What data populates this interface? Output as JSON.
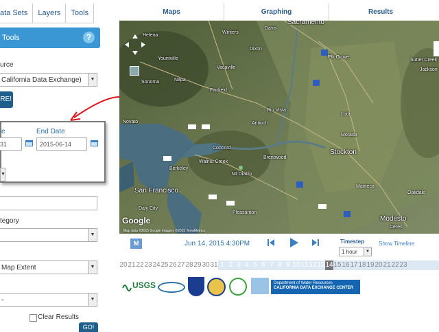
{
  "left_tabs": [
    "ata Sets",
    "Layers",
    "Tools"
  ],
  "tools_header": {
    "label": "Tools",
    "help": "?"
  },
  "source": {
    "label": "urce",
    "value": "California Data Exchange)"
  },
  "explore_button": "RE!",
  "dates": {
    "start_label": "e",
    "start_value": "31",
    "end_label": "End Date",
    "end_value": "2015-06-14"
  },
  "category": {
    "label": "tegory"
  },
  "extent": {
    "value": "Map Extent"
  },
  "clear_results": "Clear Results",
  "go_button": "GO!",
  "nav": [
    "Maps",
    "Graphing",
    "Results"
  ],
  "map": {
    "cities": [
      {
        "name": "Sacramento",
        "big": true
      },
      {
        "name": "Davis"
      },
      {
        "name": "Winters"
      },
      {
        "name": "Elk Grove"
      },
      {
        "name": "Dixon"
      },
      {
        "name": "Vacaville"
      },
      {
        "name": "Yountville"
      },
      {
        "name": "Napa"
      },
      {
        "name": "Sonoma"
      },
      {
        "name": "Fairfield"
      },
      {
        "name": "Rio Vista"
      },
      {
        "name": "Lodi"
      },
      {
        "name": "Novato"
      },
      {
        "name": "Antioch"
      },
      {
        "name": "Concord"
      },
      {
        "name": "Brentwood"
      },
      {
        "name": "Walnut Creek"
      },
      {
        "name": "Mt Diablo"
      },
      {
        "name": "Berkeley"
      },
      {
        "name": "San Francisco",
        "big": true
      },
      {
        "name": "Daly City"
      },
      {
        "name": "Pleasanton"
      },
      {
        "name": "Stockton",
        "big": true
      },
      {
        "name": "Morada"
      },
      {
        "name": "Manteca"
      },
      {
        "name": "Modesto",
        "big": true
      },
      {
        "name": "Oakdale"
      },
      {
        "name": "Ceres"
      },
      {
        "name": "Sutter Creek"
      },
      {
        "name": "Jackson"
      },
      {
        "name": "Helena"
      }
    ],
    "google": "Google",
    "attribution": "Map data ©2015 Google Imagery ©2015 TerraMetrics"
  },
  "timeline": {
    "m_label": "M",
    "current_datetime": "Jun 14, 2015 4:30PM",
    "timestep_label": "Timestep",
    "timestep_value": "1 hour",
    "show_timeline": "Show Timeline"
  },
  "days": [
    "20",
    "21",
    "22",
    "23",
    "24",
    "25",
    "26",
    "27",
    "28",
    "29",
    "30",
    "31",
    "1",
    "2",
    "3",
    "4",
    "5",
    "6",
    "7",
    "8",
    "9",
    "10",
    "11",
    "12",
    "13",
    "14",
    "15",
    "16",
    "17",
    "18",
    "19",
    "20",
    "21",
    "22",
    "23"
  ],
  "days_selected_index": 25,
  "days_range_start_index": 12,
  "logos": {
    "usgs": "USGS",
    "dwr_line1": "Department of Water Resources",
    "dwr_line2": "CALIFORNIA DATA EXCHANGE CENTER"
  },
  "colors": {
    "accent": "#3b97d3",
    "dark_button": "#1f5f8b",
    "arrow": "#e0131a"
  }
}
